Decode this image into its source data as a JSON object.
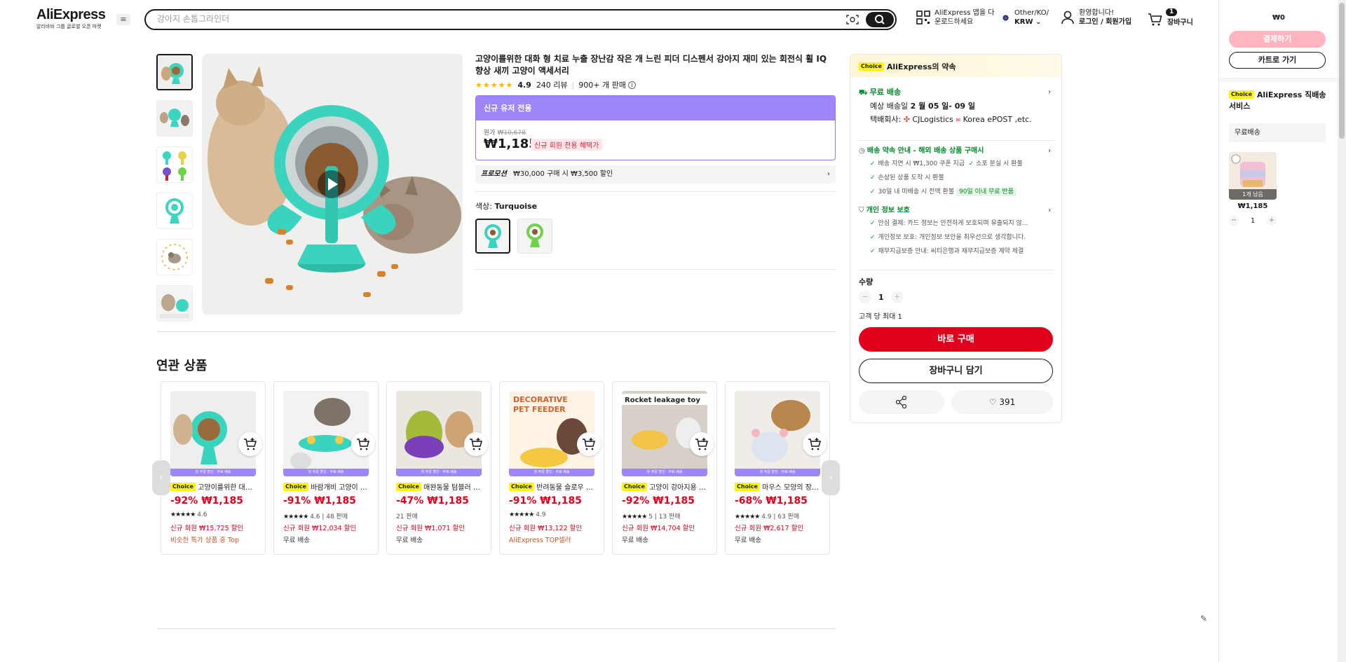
{
  "header": {
    "logo": "AliExpress",
    "logo_sub": "알리바바 그룹 글로벌 오픈 마켓",
    "search_placeholder": "강아지 손톱그라인더",
    "app_line1": "AliExpress 앱을 다",
    "app_line2": "운로드하세요",
    "locale_line1": "Other/KO/",
    "locale_line2": "KRW",
    "account_line1": "환영합니다!",
    "account_line2": "로그인 / 회원가입",
    "cart_count": "1",
    "cart_label": "장바구니"
  },
  "gallery": {
    "thumb_count": 6
  },
  "product": {
    "title": "고양이를위한 대화 형 치료 누출 장난감 작은 개 느린 피더 디스펜서 강아지 재미 있는 회전식 휠 IQ 향상 새끼 고양이 액세서리",
    "stars": "★★★★★",
    "rating": "4.9",
    "reviews": "240 리뷰",
    "sold": "900+ 개 판매",
    "promo_header": "신규 유저 전용",
    "orig_label": "원가",
    "orig_price": "₩10,678",
    "price": "₩1,185",
    "new_tag": "신규 회원 전용 혜택가",
    "promotion_label": "프로모션",
    "promotion_text": "₩30,000 구매 시 ₩3,500 할인",
    "color_label": "색상:",
    "color_value": "Turquoise"
  },
  "buybox": {
    "choice": "Choice",
    "promise": "AliExpress의 약속",
    "free_ship": "무료 배송",
    "delivery_label": "예상 배송일",
    "delivery_date": "2 월 05 일- 09 일",
    "carrier_label": "택배회사:",
    "carrier": "CJLogistics",
    "carrier2": "Korea ePOST ,etc.",
    "guarantee_title": "배송 약속 안내 - 해외 배송 상품 구매시",
    "g1": "배송 지연 시 ₩1,300 쿠폰 지급",
    "g2": "소포 분실 시 환불",
    "g3": "손상된 상품 도착 시 환불",
    "g4": "30일 내 미배송 시 전액 환불",
    "g4_tag": "90일 이내 무료 반품",
    "privacy_title": "개인 정보 보호",
    "p1": "안심 결제: 카드 정보는 안전하게 보호되며 유출되지 않...",
    "p2": "개인정보 보호: 개인정보 보안을 최우선으로 생각합니다.",
    "p3": "채무지급보증 안내: 씨티은행과 채무지급보증 계약 체결",
    "qty_label": "수량",
    "qty": "1",
    "qty_limit": "고객 당 최대 1",
    "buy_now": "바로 구매",
    "add_cart": "장바구니 담기",
    "wishlist": "391"
  },
  "right_panel": {
    "total": "₩0",
    "checkout": "결제하기",
    "go_cart": "카트로 가기",
    "choice": "Choice",
    "choice_title": "AliExpress 직배송 서비스",
    "free_ship": "무료배송",
    "remaining": "1개 남음",
    "price": "₩1,185",
    "qty": "1"
  },
  "related": {
    "title": "연관 상품",
    "strip": "첫 주문 할인 · 무료 배송",
    "items": [
      {
        "name": "고양이를위한 대화 형 치료",
        "discount": "-92%",
        "price": "₩1,185",
        "stars": "★★★★★",
        "rating": "4.6",
        "sold": "",
        "extra": "신규 회원 ₩15,725 할인",
        "extra2": "비슷한 특가 상품 중 Top",
        "choice": true
      },
      {
        "name": "바람개비 고양이 장난감",
        "discount": "-91%",
        "price": "₩1,185",
        "stars": "★★★★★",
        "rating": "4.6",
        "sold": "48 판매",
        "extra": "신규 회원 ₩12,034 할인",
        "extra2": "무료 배송",
        "choice": true
      },
      {
        "name": "애완동물 텀블러 장난감",
        "discount": "-47%",
        "price": "₩1,185",
        "stars": "",
        "rating": "",
        "sold": "21 판매",
        "extra": "신규 회원 ₩1,071 할인",
        "extra2": "무료 배송",
        "choice": true
      },
      {
        "name": "반려동물 슬로우 피더",
        "discount": "-91%",
        "price": "₩1,185",
        "stars": "★★★★★",
        "rating": "4.9",
        "sold": "",
        "extra": "신규 회원 ₩13,122 할인",
        "extra2": "AliExpress TOP셀러",
        "choice": true
      },
      {
        "name": "고양이 강아지용 누출 장난감",
        "discount": "-92%",
        "price": "₩1,185",
        "stars": "★★★★★",
        "rating": "5",
        "sold": "13 판매",
        "extra": "신규 회원 ₩14,704 할인",
        "extra2": "무료 배송",
        "choice": true
      },
      {
        "name": "마우스 모양의 장난감",
        "discount": "-68%",
        "price": "₩1,185",
        "stars": "★★★★★",
        "rating": "4.9",
        "sold": "63 판매",
        "extra": "신규 회원 ₩2,617 할인",
        "extra2": "무료 배송",
        "choice": true
      }
    ]
  }
}
